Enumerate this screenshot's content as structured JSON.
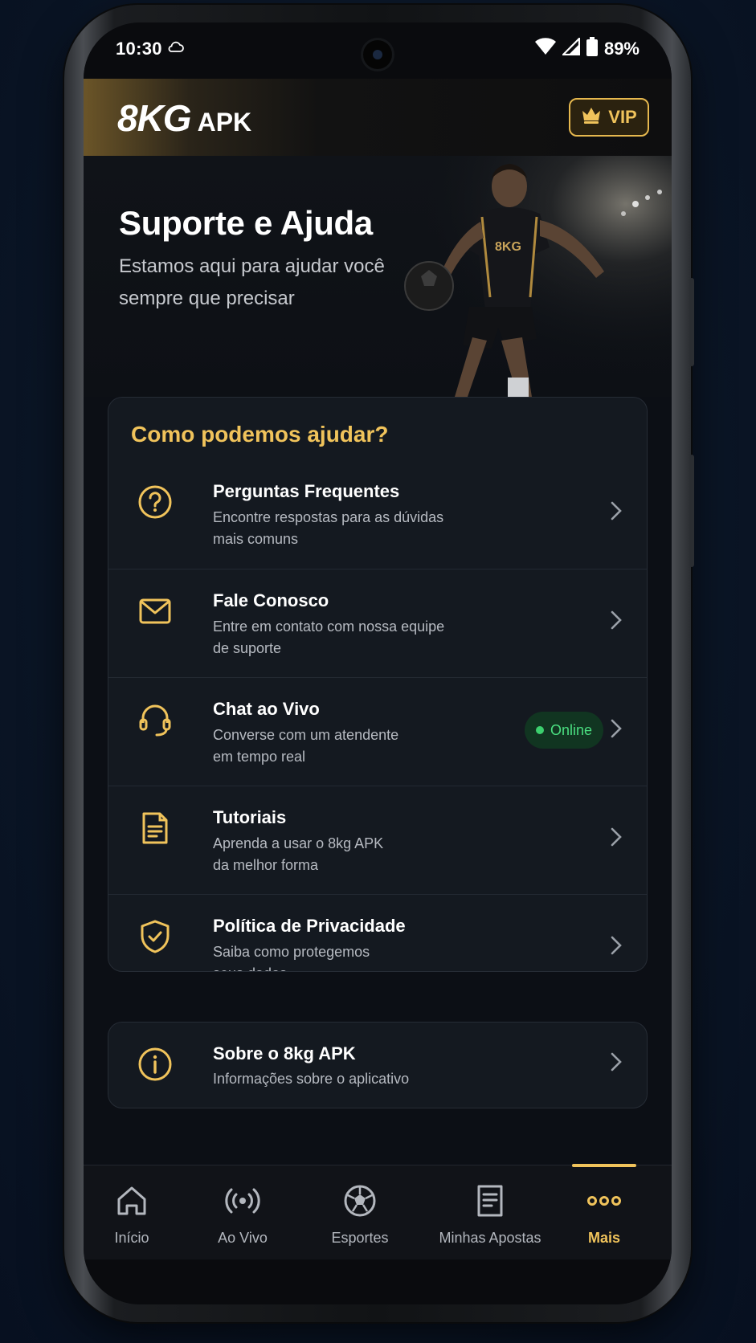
{
  "status_bar": {
    "time": "10:30",
    "battery": "89%"
  },
  "header": {
    "logo_main": "8KG",
    "logo_sub": "APK",
    "vip_label": "VIP"
  },
  "hero": {
    "title": "Suporte e Ajuda",
    "subtitle": "Estamos aqui para ajudar você sempre que precisar",
    "jersey_text": "8KG"
  },
  "help": {
    "title": "Como podemos ajudar?",
    "items": [
      {
        "icon": "question-circle-icon",
        "title": "Perguntas Frequentes",
        "desc_line1": "Encontre respostas para as dúvidas",
        "desc_line2": "mais comuns"
      },
      {
        "icon": "mail-icon",
        "title": "Fale Conosco",
        "desc_line1": "Entre em contato com nossa equipe",
        "desc_line2": "de suporte"
      },
      {
        "icon": "headset-icon",
        "title": "Chat ao Vivo",
        "desc_line1": "Converse com um atendente",
        "desc_line2": "em tempo real",
        "badge": "Online"
      },
      {
        "icon": "document-icon",
        "title": "Tutoriais",
        "desc_line1": "Aprenda a usar o 8kg APK",
        "desc_line2": "da melhor forma"
      },
      {
        "icon": "shield-check-icon",
        "title": "Política de Privacidade",
        "desc_line1": "Saiba como protegemos",
        "desc_line2": "seus dados"
      }
    ]
  },
  "about": {
    "icon": "info-circle-icon",
    "title": "Sobre o 8kg APK",
    "desc": "Informações sobre o aplicativo"
  },
  "nav": {
    "items": [
      {
        "label": "Início",
        "icon": "home-icon"
      },
      {
        "label": "Ao Vivo",
        "icon": "broadcast-icon"
      },
      {
        "label": "Esportes",
        "icon": "soccer-ball-icon"
      },
      {
        "label": "Minhas Apostas",
        "icon": "receipt-icon"
      },
      {
        "label": "Mais",
        "icon": "more-dots-icon",
        "active": true
      }
    ]
  },
  "colors": {
    "accent": "#f0c35b",
    "background": "#0c0f15",
    "card": "#141920",
    "online": "#4ade80"
  }
}
